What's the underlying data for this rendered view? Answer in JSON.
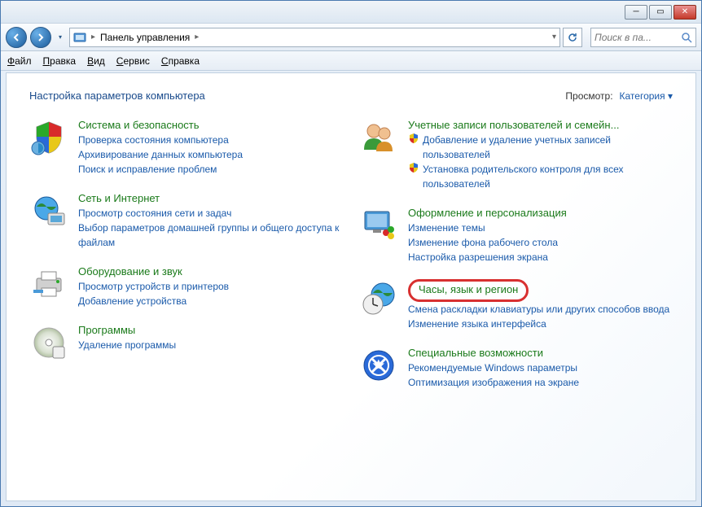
{
  "breadcrumb": {
    "root": "Панель управления"
  },
  "search": {
    "placeholder": "Поиск в па..."
  },
  "menu": {
    "file": "Файл",
    "edit": "Правка",
    "view": "Вид",
    "tools": "Сервис",
    "help": "Справка"
  },
  "header": {
    "title": "Настройка параметров компьютера",
    "view_label": "Просмотр:",
    "view_value": "Категория"
  },
  "cats": {
    "system": {
      "title": "Система и безопасность",
      "links": [
        "Проверка состояния компьютера",
        "Архивирование данных компьютера",
        "Поиск и исправление проблем"
      ]
    },
    "network": {
      "title": "Сеть и Интернет",
      "links": [
        "Просмотр состояния сети и задач",
        "Выбор параметров домашней группы и общего доступа к файлам"
      ]
    },
    "hardware": {
      "title": "Оборудование и звук",
      "links": [
        "Просмотр устройств и принтеров",
        "Добавление устройства"
      ]
    },
    "programs": {
      "title": "Программы",
      "links": [
        "Удаление программы"
      ]
    },
    "users": {
      "title": "Учетные записи пользователей и семейн...",
      "shield_links": [
        "Добавление и удаление учетных записей пользователей",
        "Установка родительского контроля для всех пользователей"
      ]
    },
    "appearance": {
      "title": "Оформление и персонализация",
      "links": [
        "Изменение темы",
        "Изменение фона рабочего стола",
        "Настройка разрешения экрана"
      ]
    },
    "clock": {
      "title": "Часы, язык и регион",
      "links": [
        "Смена раскладки клавиатуры или других способов ввода",
        "Изменение языка интерфейса"
      ]
    },
    "access": {
      "title": "Специальные возможности",
      "links": [
        "Рекомендуемые Windows параметры",
        "Оптимизация изображения на экране"
      ]
    }
  }
}
